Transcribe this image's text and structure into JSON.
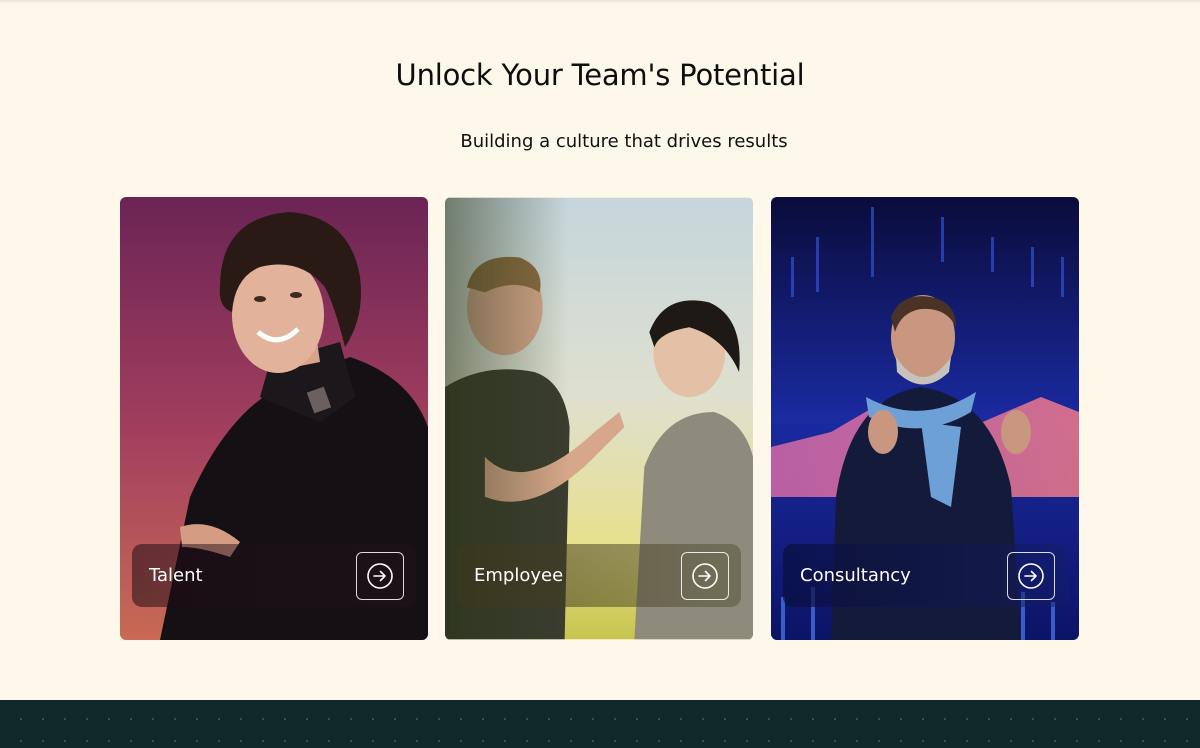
{
  "section": {
    "title": "Unlock Your Team's Potential",
    "subtitle": "Building a culture that drives results"
  },
  "cards": [
    {
      "label": "Talent",
      "icon": "arrow-right-circle-icon",
      "image": "smiling-woman-photo"
    },
    {
      "label": "Employee",
      "icon": "arrow-right-circle-icon",
      "image": "two-colleagues-talking-photo"
    },
    {
      "label": "Consultancy",
      "icon": "arrow-right-circle-icon",
      "image": "presenter-speaking-photo"
    }
  ],
  "colors": {
    "background": "#fdf8ea",
    "footer": "#11282a",
    "text": "#0e0e0e"
  }
}
